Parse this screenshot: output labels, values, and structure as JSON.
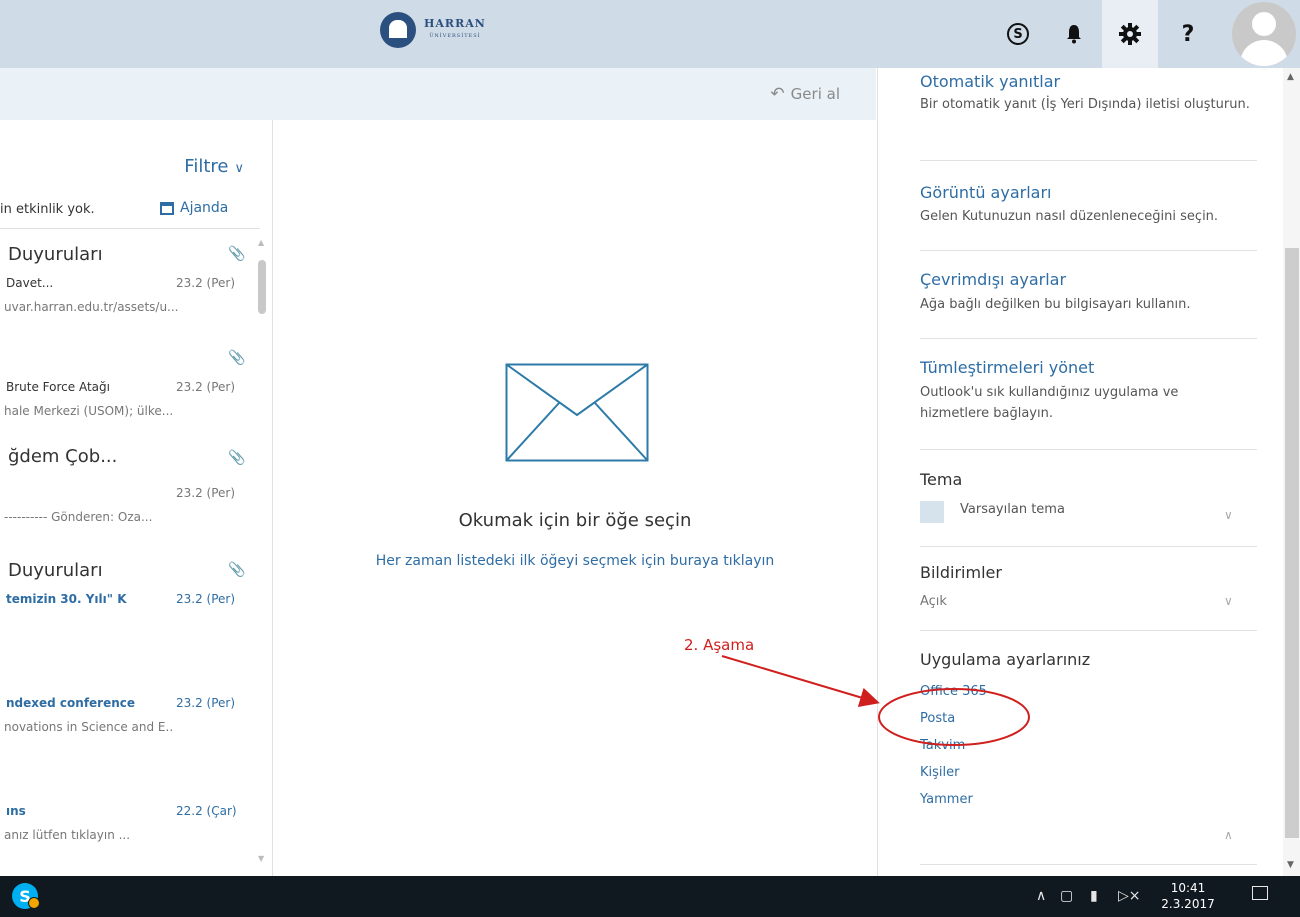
{
  "header": {
    "logo_text": "HARRAN",
    "logo_subtext": "ÜNİVERSİTESİ",
    "icons": [
      "skype-icon",
      "bell-icon",
      "gear-icon",
      "help-icon",
      "avatar"
    ],
    "help_glyph": "?"
  },
  "undo": {
    "label": "Geri al"
  },
  "message_list": {
    "filter_label": "Filtre",
    "no_events": "in etkinlik yok.",
    "agenda_label": "Ajanda",
    "items": [
      {
        "from": "Duyuruları",
        "subject": "Davet...",
        "date": "23.2 (Per)",
        "preview": "uvar.harran.edu.tr/assets/u..."
      },
      {
        "from": "",
        "subject": "Brute Force Atağı",
        "date": "23.2 (Per)",
        "preview": "hale Merkezi (USOM); ülke..."
      },
      {
        "from": "ğdem Çob...",
        "subject": "",
        "date": "23.2 (Per)",
        "preview": "---------- Gönderen: Oza..."
      },
      {
        "from": "Duyuruları",
        "subject": "temizin 30. Yılı\" K",
        "date": "23.2 (Per)",
        "preview": ""
      },
      {
        "from": "",
        "subject": "ndexed conference",
        "date": "23.2 (Per)",
        "preview": "novations in Science and E.."
      },
      {
        "from": "",
        "subject": "ıns",
        "date": "22.2 (Çar)",
        "preview": "anız lütfen tıklayın         ..."
      }
    ]
  },
  "reading_pane": {
    "empty_title": "Okumak için bir öğe seçin",
    "empty_link": "Her zaman listedeki ilk öğeyi seçmek için buraya tıklayın"
  },
  "settings": {
    "sections": [
      {
        "title": "Otomatik yanıtlar",
        "desc": "Bir otomatik yanıt (İş Yeri Dışında) iletisi oluşturun."
      },
      {
        "title": "Görüntü ayarları",
        "desc": "Gelen Kutunuzun nasıl düzenleneceğini seçin."
      },
      {
        "title": "Çevrimdışı ayarlar",
        "desc": "Ağa bağlı değilken bu bilgisayarı kullanın."
      },
      {
        "title": "Tümleştirmeleri yönet",
        "desc": "Outlook'u sık kullandığınız uygulama ve hizmetlere bağlayın."
      }
    ],
    "theme_title": "Tema",
    "theme_value": "Varsayılan tema",
    "notifications_title": "Bildirimler",
    "notifications_value": "Açık",
    "app_settings_title": "Uygulama ayarlarınız",
    "apps": [
      "Office 365",
      "Posta",
      "Takvim",
      "Kişiler",
      "Yammer"
    ]
  },
  "annotation": {
    "label": "2. Aşama",
    "color": "#d0201e"
  },
  "taskbar": {
    "time": "10:41",
    "date": "2.3.2017"
  },
  "colors": {
    "accent": "#2e6da4",
    "topbar": "#cfdbe6"
  }
}
